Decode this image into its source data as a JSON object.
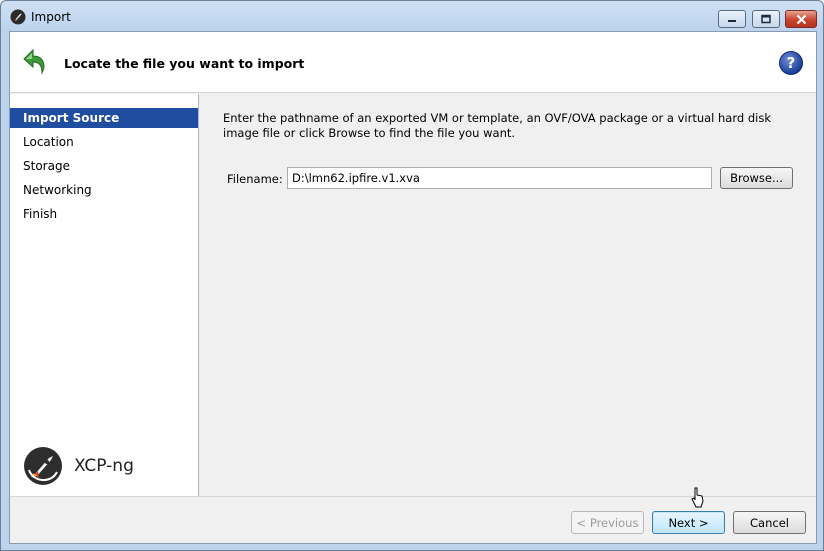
{
  "window": {
    "title": "Import"
  },
  "header": {
    "title": "Locate the file you want to import",
    "help_label": "?"
  },
  "sidebar": {
    "items": [
      {
        "label": "Import Source",
        "active": true
      },
      {
        "label": "Location",
        "active": false
      },
      {
        "label": "Storage",
        "active": false
      },
      {
        "label": "Networking",
        "active": false
      },
      {
        "label": "Finish",
        "active": false
      }
    ],
    "brand": "XCP-ng"
  },
  "main": {
    "description": "Enter the pathname of an exported VM or template, an OVF/OVA package or a virtual hard disk image file or click Browse to find the file you want.",
    "filename_label": "Filename:",
    "filename_value": "D:\\lmn62.ipfire.v1.xva",
    "browse_label": "Browse..."
  },
  "footer": {
    "previous_label": "< Previous",
    "next_label": "Next >",
    "cancel_label": "Cancel"
  },
  "colors": {
    "selection": "#1f4ea1",
    "help": "#1d3f9a",
    "close": "#c9452f"
  }
}
